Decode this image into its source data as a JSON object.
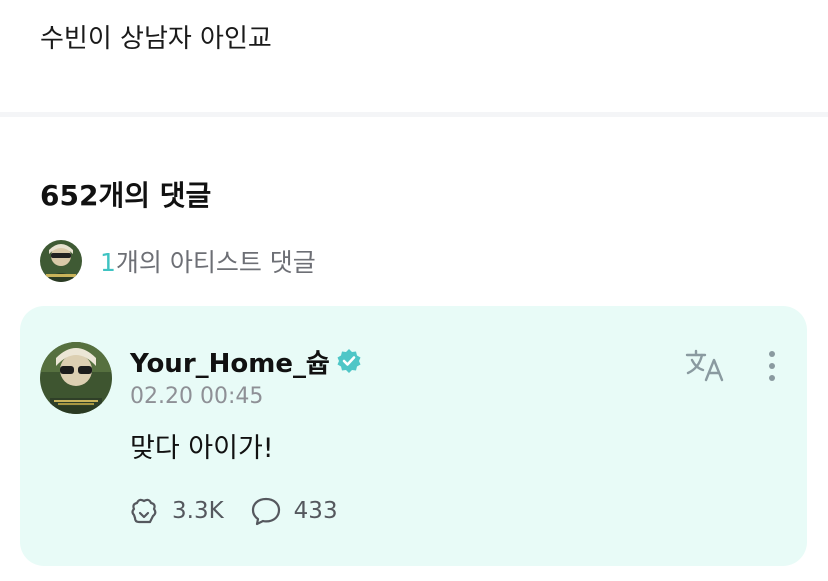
{
  "post": {
    "text": "수빈이 상남자 아인교"
  },
  "comments": {
    "count_label": "652개의 댓글",
    "artist_summary": {
      "count": "1",
      "label": "개의 아티스트 댓글"
    },
    "featured": {
      "author": "Your_Home_슙",
      "verified_icon": "verified-badge-icon",
      "timestamp": "02.20 00:45",
      "body": "맞다 아이가!",
      "likes": "3.3K",
      "replies": "433",
      "translate_icon": "translate-icon",
      "more_icon": "more-vertical-icon"
    }
  },
  "colors": {
    "accent": "#3fc3c2",
    "card_bg": "#e8fbf7",
    "muted_text": "#8e9096",
    "icon_gray": "#8a9aa0"
  }
}
